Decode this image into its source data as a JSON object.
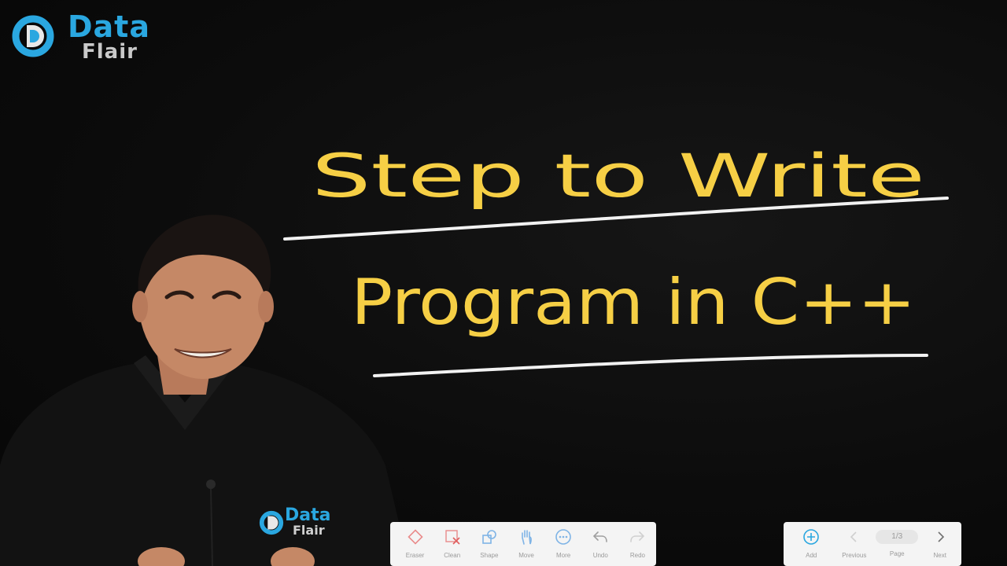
{
  "brand": {
    "name_line1": "Data",
    "name_line2": "Flair",
    "accent_color": "#2aa7e0",
    "secondary_color": "#c9c9c9"
  },
  "board": {
    "line1": "Step to Write",
    "line2": "Program in C++",
    "ink_color": "#f6cf45",
    "underline_color": "#f2f2f2",
    "background_color": "#0b0b0b"
  },
  "shirt_logo": {
    "name_line1": "Data",
    "name_line2": "Flair"
  },
  "toolbar_left": {
    "items": [
      {
        "label": "Eraser",
        "icon": "eraser-icon"
      },
      {
        "label": "Clean",
        "icon": "clean-icon"
      },
      {
        "label": "Shape",
        "icon": "shape-icon"
      },
      {
        "label": "Move",
        "icon": "move-hand-icon"
      },
      {
        "label": "More",
        "icon": "more-icon"
      },
      {
        "label": "Undo",
        "icon": "undo-icon"
      },
      {
        "label": "Redo",
        "icon": "redo-icon"
      }
    ]
  },
  "toolbar_right": {
    "add_label": "Add",
    "previous_label": "Previous",
    "page_indicator": "1/3",
    "page_label": "Page",
    "next_label": "Next",
    "accent_color": "#2aa7e0"
  }
}
